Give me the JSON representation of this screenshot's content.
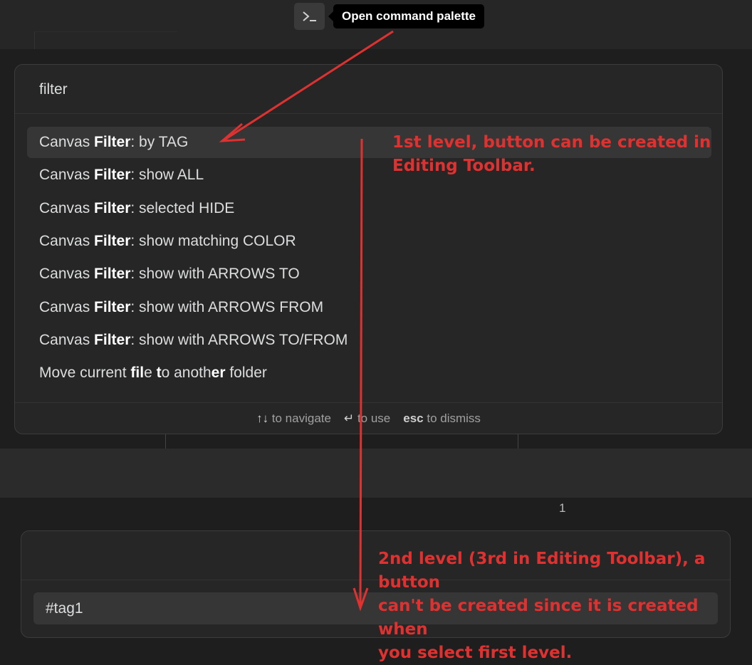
{
  "tooltip": "Open command palette",
  "palette": {
    "query": "filter",
    "results": [
      {
        "prefix": "Canvas ",
        "match": "Filter",
        "suffix": ": by TAG"
      },
      {
        "prefix": "Canvas ",
        "match": "Filter",
        "suffix": ": show ALL"
      },
      {
        "prefix": "Canvas ",
        "match": "Filter",
        "suffix": ": selected HIDE"
      },
      {
        "prefix": "Canvas ",
        "match": "Filter",
        "suffix": ": show matching COLOR"
      },
      {
        "prefix": "Canvas ",
        "match": "Filter",
        "suffix": ": show with ARROWS TO"
      },
      {
        "prefix": "Canvas ",
        "match": "Filter",
        "suffix": ": show with ARROWS FROM"
      },
      {
        "prefix": "Canvas ",
        "match": "Filter",
        "suffix": ": show with ARROWS TO/FROM"
      }
    ],
    "last_result": {
      "p1": "Move current ",
      "m1": "fil",
      "p2": "e ",
      "m2": "t",
      "p3": "o anoth",
      "m3": "er",
      "p4": " folder"
    },
    "footer": {
      "navigate_key": "↑↓",
      "navigate_text": " to navigate",
      "use_key": "↵",
      "use_text": " to use",
      "dismiss_key": "esc",
      "dismiss_text": " to dismiss"
    }
  },
  "page_number": "1",
  "tag_item": "#tag1",
  "annotations": {
    "first_line1": "1st level, button can be created in",
    "first_line2": "Editing Toolbar.",
    "second_line1": "2nd level (3rd in Editing Toolbar), a button",
    "second_line2": "can't be created since it is created when",
    "second_line3": "you select first level."
  },
  "colors": {
    "annotation": "#e03131",
    "selected_row": "#363636",
    "panel": "#262626"
  }
}
